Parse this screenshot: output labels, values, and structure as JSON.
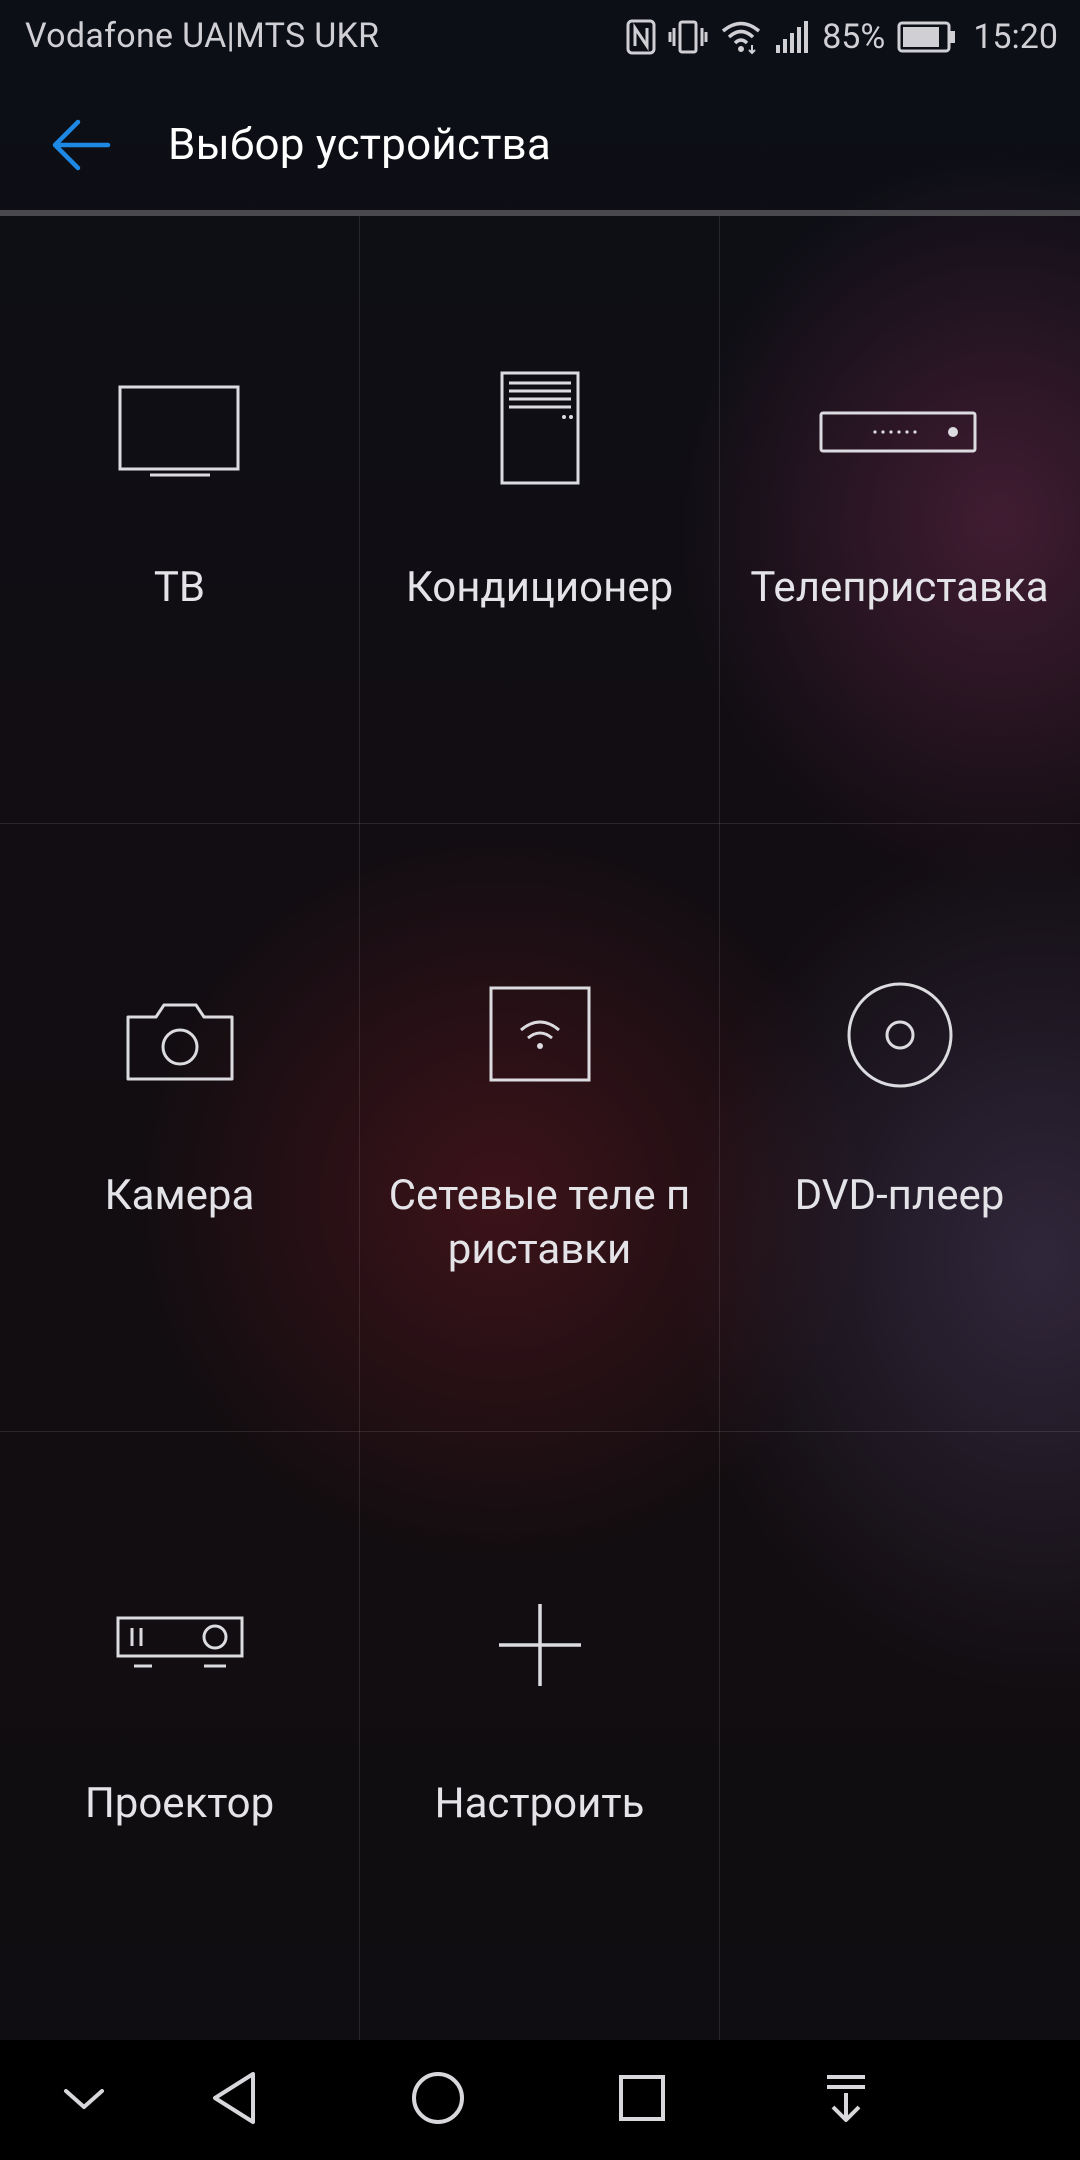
{
  "status_bar": {
    "carrier": "Vodafone UA|MTS UKR",
    "battery": "85%",
    "time": "15:20",
    "icons": [
      "nfc-icon",
      "vibrate-icon",
      "wifi-icon",
      "signal-icon",
      "battery-icon"
    ]
  },
  "app_bar": {
    "title": "Выбор устройства",
    "back_icon": "arrow-left-icon",
    "accent_color": "#1e88e5"
  },
  "devices": [
    {
      "label": "ТВ",
      "icon": "tv-icon"
    },
    {
      "label": "Кондиционер",
      "icon": "air-conditioner-icon"
    },
    {
      "label": "Телеприставка",
      "icon": "set-top-box-icon"
    },
    {
      "label": "Камера",
      "icon": "camera-icon"
    },
    {
      "label": "Сетевые теле приставки",
      "icon": "network-box-icon"
    },
    {
      "label": "DVD-плеер",
      "icon": "disc-icon"
    },
    {
      "label": "Проектор",
      "icon": "projector-icon"
    },
    {
      "label": "Настроить",
      "icon": "plus-icon"
    }
  ],
  "nav_bar": {
    "icons": [
      "chevron-down-icon",
      "back-triangle-icon",
      "home-circle-icon",
      "recents-square-icon",
      "notifications-pull-icon"
    ]
  }
}
